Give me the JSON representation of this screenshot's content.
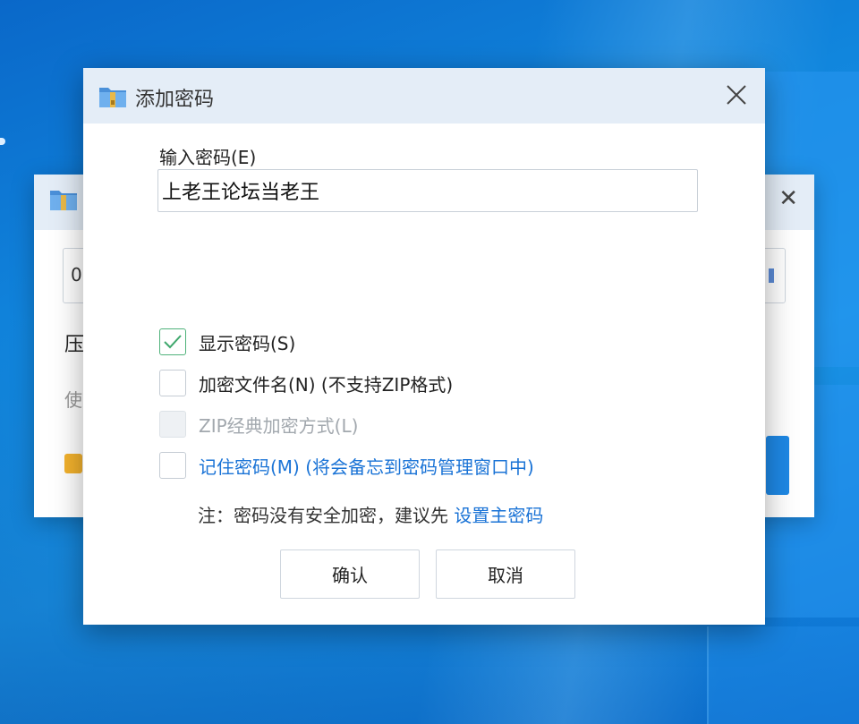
{
  "dialog": {
    "title": "添加密码",
    "password_label": "输入密码(E)",
    "password_value": "上老王论坛当老王",
    "options": {
      "show_password": "显示密码(S)",
      "encrypt_filenames": "加密文件名(N) (不支持ZIP格式)",
      "zip_classic": "ZIP经典加密方式(L)",
      "remember_password": "记住密码(M) (将会备忘到密码管理窗口中)"
    },
    "note_prefix": "注：密码没有安全加密，建议先 ",
    "note_link": "设置主密码",
    "ok_label": "确认",
    "cancel_label": "取消"
  },
  "background_window": {
    "field_value": "0",
    "label_1": "压",
    "label_2": "使"
  },
  "colors": {
    "title_bar": "#e4edf7",
    "link": "#1a73d6",
    "check": "#4fb27a",
    "desktop": "#1186dd"
  },
  "icons": [
    "archive-folder-icon",
    "close-icon",
    "checkmark-icon"
  ]
}
